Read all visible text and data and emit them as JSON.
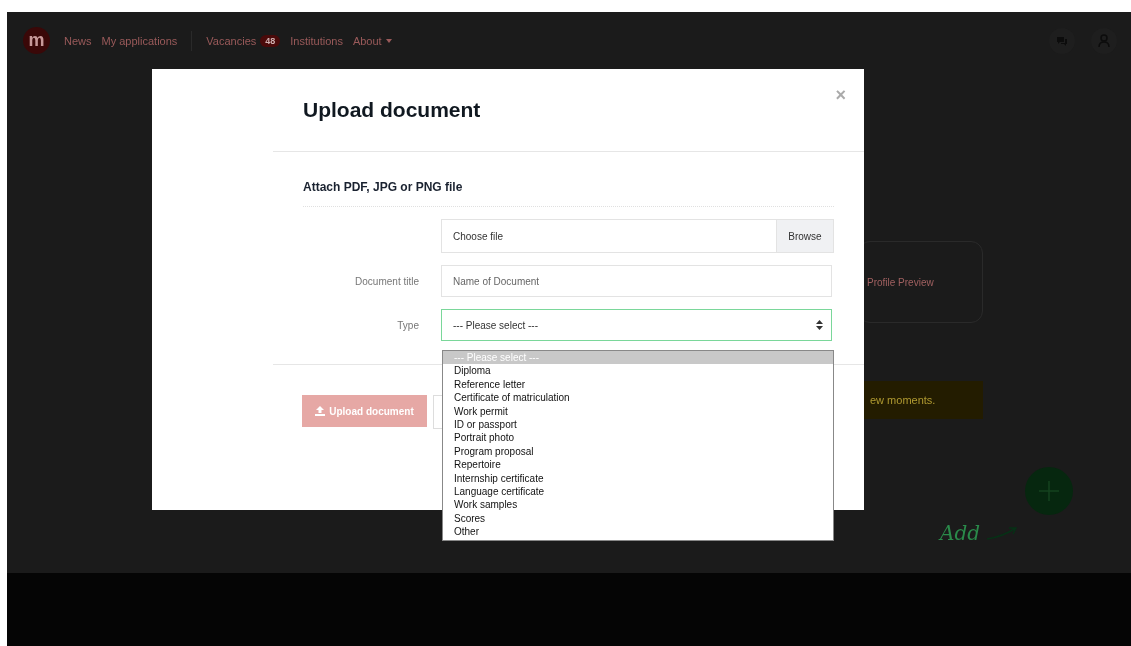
{
  "nav": {
    "logo": "m",
    "items": [
      {
        "label": "News",
        "dropdown": false
      },
      {
        "label": "My applications",
        "dropdown": false
      },
      {
        "label": "Vacancies",
        "badge": "48",
        "dropdown": false
      },
      {
        "label": "Institutions",
        "dropdown": false
      },
      {
        "label": "About",
        "dropdown": true
      }
    ]
  },
  "background": {
    "profile_card": "Profile Preview",
    "notice": "ew moments.",
    "add_hint": "Add"
  },
  "modal": {
    "title": "Upload document",
    "close": "×",
    "section_title": "Attach PDF, JPG or PNG file",
    "file_field": {
      "placeholder": "Choose file",
      "button": "Browse"
    },
    "fields": [
      {
        "label": "Document title",
        "kind": "text",
        "placeholder": "Name of Document"
      },
      {
        "label": "Type",
        "kind": "select",
        "value": "--- Please select ---",
        "expanded": true
      }
    ],
    "options": [
      {
        "label": "--- Please select ---",
        "selected": true
      },
      {
        "label": "Diploma",
        "selected": false
      },
      {
        "label": "Reference letter",
        "selected": false
      },
      {
        "label": "Certificate of matriculation",
        "selected": false
      },
      {
        "label": "Work permit",
        "selected": false
      },
      {
        "label": "ID or passport",
        "selected": false
      },
      {
        "label": "Portrait photo",
        "selected": false
      },
      {
        "label": "Program proposal",
        "selected": false
      },
      {
        "label": "Repertoire",
        "selected": false
      },
      {
        "label": "Internship certificate",
        "selected": false
      },
      {
        "label": "Language certificate",
        "selected": false
      },
      {
        "label": "Work samples",
        "selected": false
      },
      {
        "label": "Scores",
        "selected": false
      },
      {
        "label": "Other",
        "selected": false
      }
    ],
    "submit": {
      "label": "Upload document",
      "disabled": true
    }
  }
}
